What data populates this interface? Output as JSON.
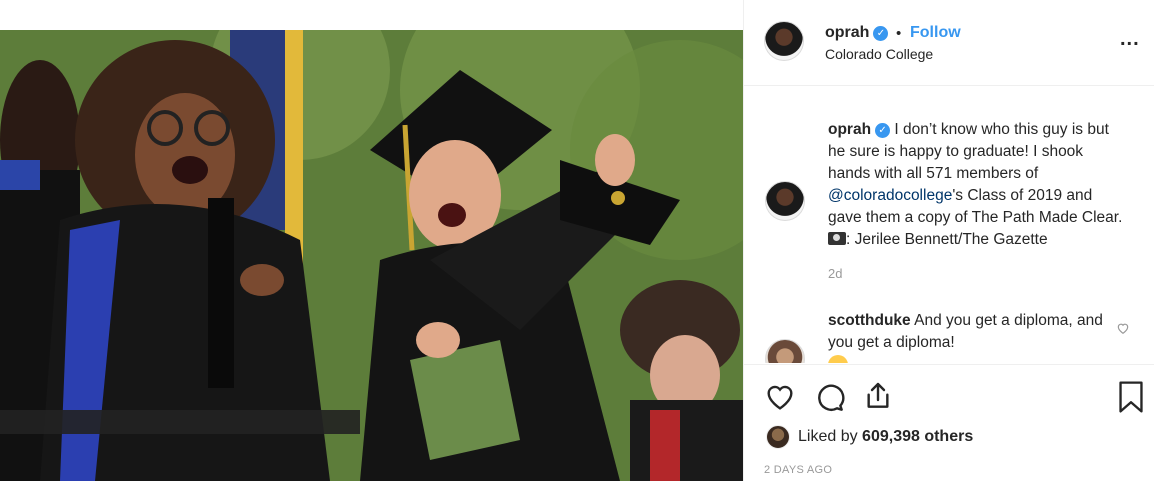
{
  "post": {
    "username": "oprah",
    "follow_label": "Follow",
    "separator": "•",
    "location": "Colorado College",
    "more_label": "...",
    "caption": {
      "username": "oprah",
      "text_before_mention": " I don’t know who this guy is but he sure is happy to graduate! I shook hands with all 571 members of ",
      "mention": "@coloradocollege",
      "text_after_mention": "'s Class of 2019 and gave them a copy of The Path Made Clear. ",
      "credit": ": Jerilee Bennett/The Gazette",
      "age": "2d"
    },
    "comments": [
      {
        "username": "scotthduke",
        "text": " And you get a diploma, and you get a diploma!"
      }
    ],
    "likes_prefix": "Liked by ",
    "likes_count": "609,398 others",
    "timestamp": "2 DAYS AGO"
  },
  "icons": {
    "verified": "verified-badge-icon",
    "like": "heart-icon",
    "comment": "comment-bubble-icon",
    "share": "share-icon",
    "save": "bookmark-icon",
    "camera": "camera-emoji"
  },
  "colors": {
    "link_blue": "#3897f0",
    "mention": "#003569",
    "muted": "#999999",
    "text": "#262626",
    "border": "#efefef"
  }
}
